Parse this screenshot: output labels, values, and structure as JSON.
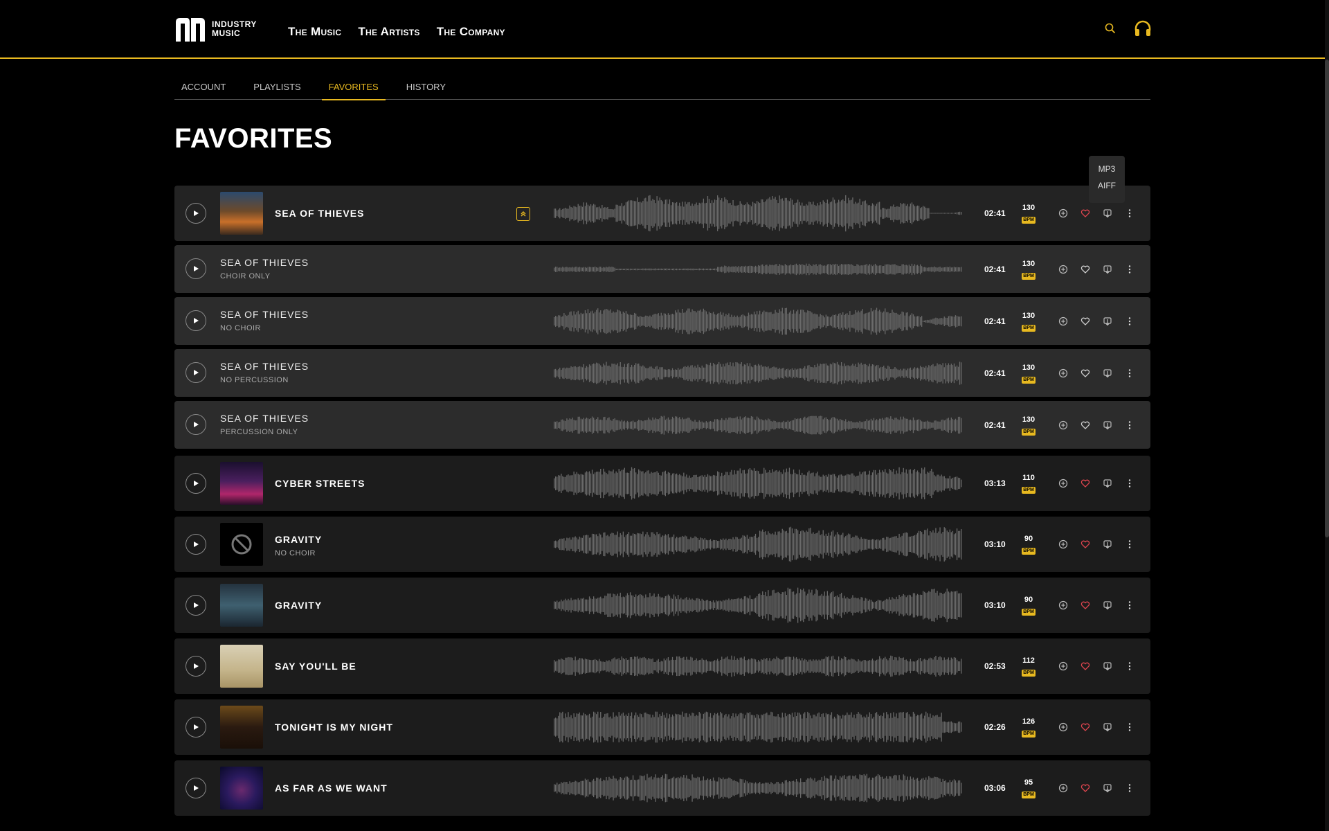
{
  "brand": {
    "line1": "INDUSTRY",
    "line2": "MUSIC"
  },
  "nav": {
    "music": "The Music",
    "artists": "The Artists",
    "company": "The Company"
  },
  "header_icons": [
    "search-icon",
    "headphones-icon"
  ],
  "tabs": [
    {
      "label": "ACCOUNT",
      "active": false
    },
    {
      "label": "PLAYLISTS",
      "active": false
    },
    {
      "label": "FAVORITES",
      "active": true
    },
    {
      "label": "HISTORY",
      "active": false
    }
  ],
  "page_title": "FAVORITES",
  "download_menu": {
    "options": [
      "MP3",
      "AIFF"
    ]
  },
  "bpm_label": "BPM",
  "tracks": [
    {
      "title": "SEA OF THIEVES",
      "duration": "02:41",
      "bpm": "130",
      "favorite": true
    },
    {
      "title": "SEA OF THIEVES",
      "subtitle": "CHOIR ONLY",
      "duration": "02:41",
      "bpm": "130",
      "favorite": false
    },
    {
      "title": "SEA OF THIEVES",
      "subtitle": "NO CHOIR",
      "duration": "02:41",
      "bpm": "130",
      "favorite": false
    },
    {
      "title": "SEA OF THIEVES",
      "subtitle": "NO PERCUSSION",
      "duration": "02:41",
      "bpm": "130",
      "favorite": false
    },
    {
      "title": "SEA OF THIEVES",
      "subtitle": "PERCUSSION ONLY",
      "duration": "02:41",
      "bpm": "130",
      "favorite": false
    },
    {
      "title": "CYBER STREETS",
      "duration": "03:13",
      "bpm": "110",
      "favorite": true
    },
    {
      "title": "GRAVITY",
      "subtitle": "NO CHOIR",
      "duration": "03:10",
      "bpm": "90",
      "favorite": true
    },
    {
      "title": "GRAVITY",
      "duration": "03:10",
      "bpm": "90",
      "favorite": true
    },
    {
      "title": "SAY YOU'LL BE",
      "duration": "02:53",
      "bpm": "112",
      "favorite": true
    },
    {
      "title": "TONIGHT IS MY NIGHT",
      "duration": "02:26",
      "bpm": "126",
      "favorite": true
    },
    {
      "title": "AS FAR AS WE WANT",
      "duration": "03:06",
      "bpm": "95",
      "favorite": true
    }
  ],
  "colors": {
    "accent": "#e8b920",
    "favorite": "#e0454f",
    "row_bg": "#1c1c1c",
    "sub_row_bg": "#2c2c2c",
    "waveform": "#6b6b6b"
  }
}
